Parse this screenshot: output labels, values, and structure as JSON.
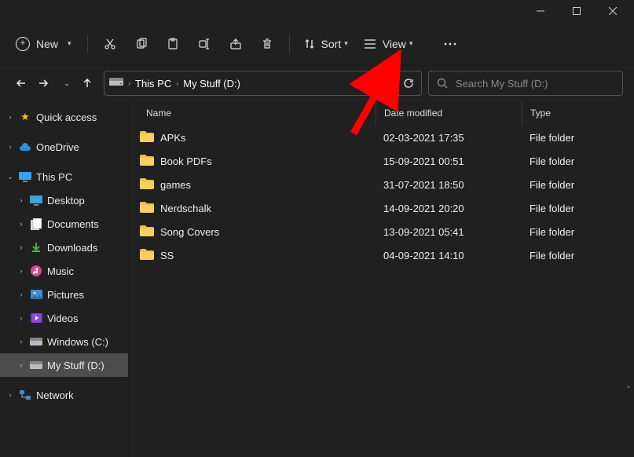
{
  "titlebar": {},
  "toolbar": {
    "new_label": "New",
    "sort_label": "Sort",
    "view_label": "View"
  },
  "nav": {
    "breadcrumb": [
      "This PC",
      "My Stuff (D:)"
    ]
  },
  "search": {
    "placeholder": "Search My Stuff (D:)"
  },
  "sidebar": {
    "quick_access": "Quick access",
    "onedrive": "OneDrive",
    "this_pc": "This PC",
    "desktop": "Desktop",
    "documents": "Documents",
    "downloads": "Downloads",
    "music": "Music",
    "pictures": "Pictures",
    "videos": "Videos",
    "windows_c": "Windows (C:)",
    "my_stuff_d": "My Stuff (D:)",
    "network": "Network"
  },
  "columns": {
    "name": "Name",
    "date": "Date modified",
    "type": "Type"
  },
  "type_folder": "File folder",
  "files": [
    {
      "name": "APKs",
      "date": "02-03-2021 17:35"
    },
    {
      "name": "Book PDFs",
      "date": "15-09-2021 00:51"
    },
    {
      "name": "games",
      "date": "31-07-2021 18:50"
    },
    {
      "name": "Nerdschalk",
      "date": "14-09-2021 20:20"
    },
    {
      "name": "Song Covers",
      "date": "13-09-2021 05:41"
    },
    {
      "name": "SS",
      "date": "04-09-2021 14:10"
    }
  ]
}
